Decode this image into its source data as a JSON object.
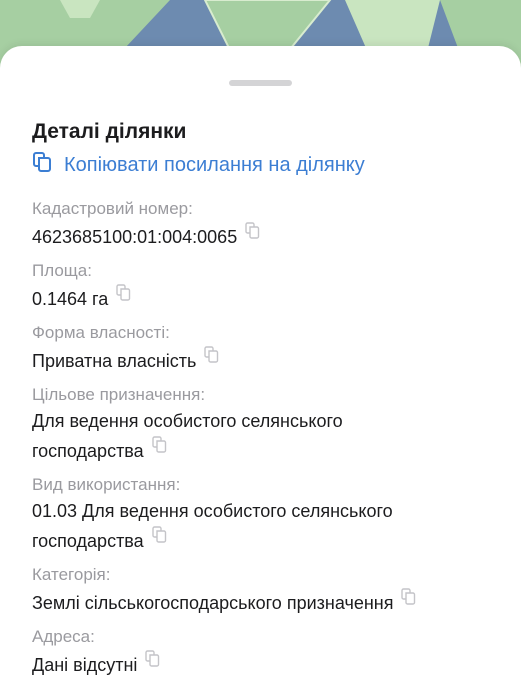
{
  "map": {
    "colors": {
      "background": "#6d8bb0",
      "parcel": "#a6cfa2",
      "parcel_light": "#c9e5c0",
      "outline": "#d8eccf"
    }
  },
  "sheet": {
    "title": "Деталі ділянки",
    "copy_link_label": "Копіювати посилання на ділянку",
    "accent_color": "#3c7ed3",
    "fields": [
      {
        "label": "Кадастровий номер:",
        "value": "4623685100:01:004:0065"
      },
      {
        "label": "Площа:",
        "value": "0.1464 га"
      },
      {
        "label": "Форма власності:",
        "value": "Приватна власність"
      },
      {
        "label": "Цільове призначення:",
        "value_line1": "Для ведення особистого селянського",
        "value_line2": "господарства"
      },
      {
        "label": "Вид використання:",
        "value_line1": "01.03 Для ведення особистого селянського",
        "value_line2": "господарства"
      },
      {
        "label": "Категорія:",
        "value": "Землі сільськогосподарського призначення"
      },
      {
        "label": "Адреса:",
        "value": "Дані відсутні"
      }
    ]
  }
}
